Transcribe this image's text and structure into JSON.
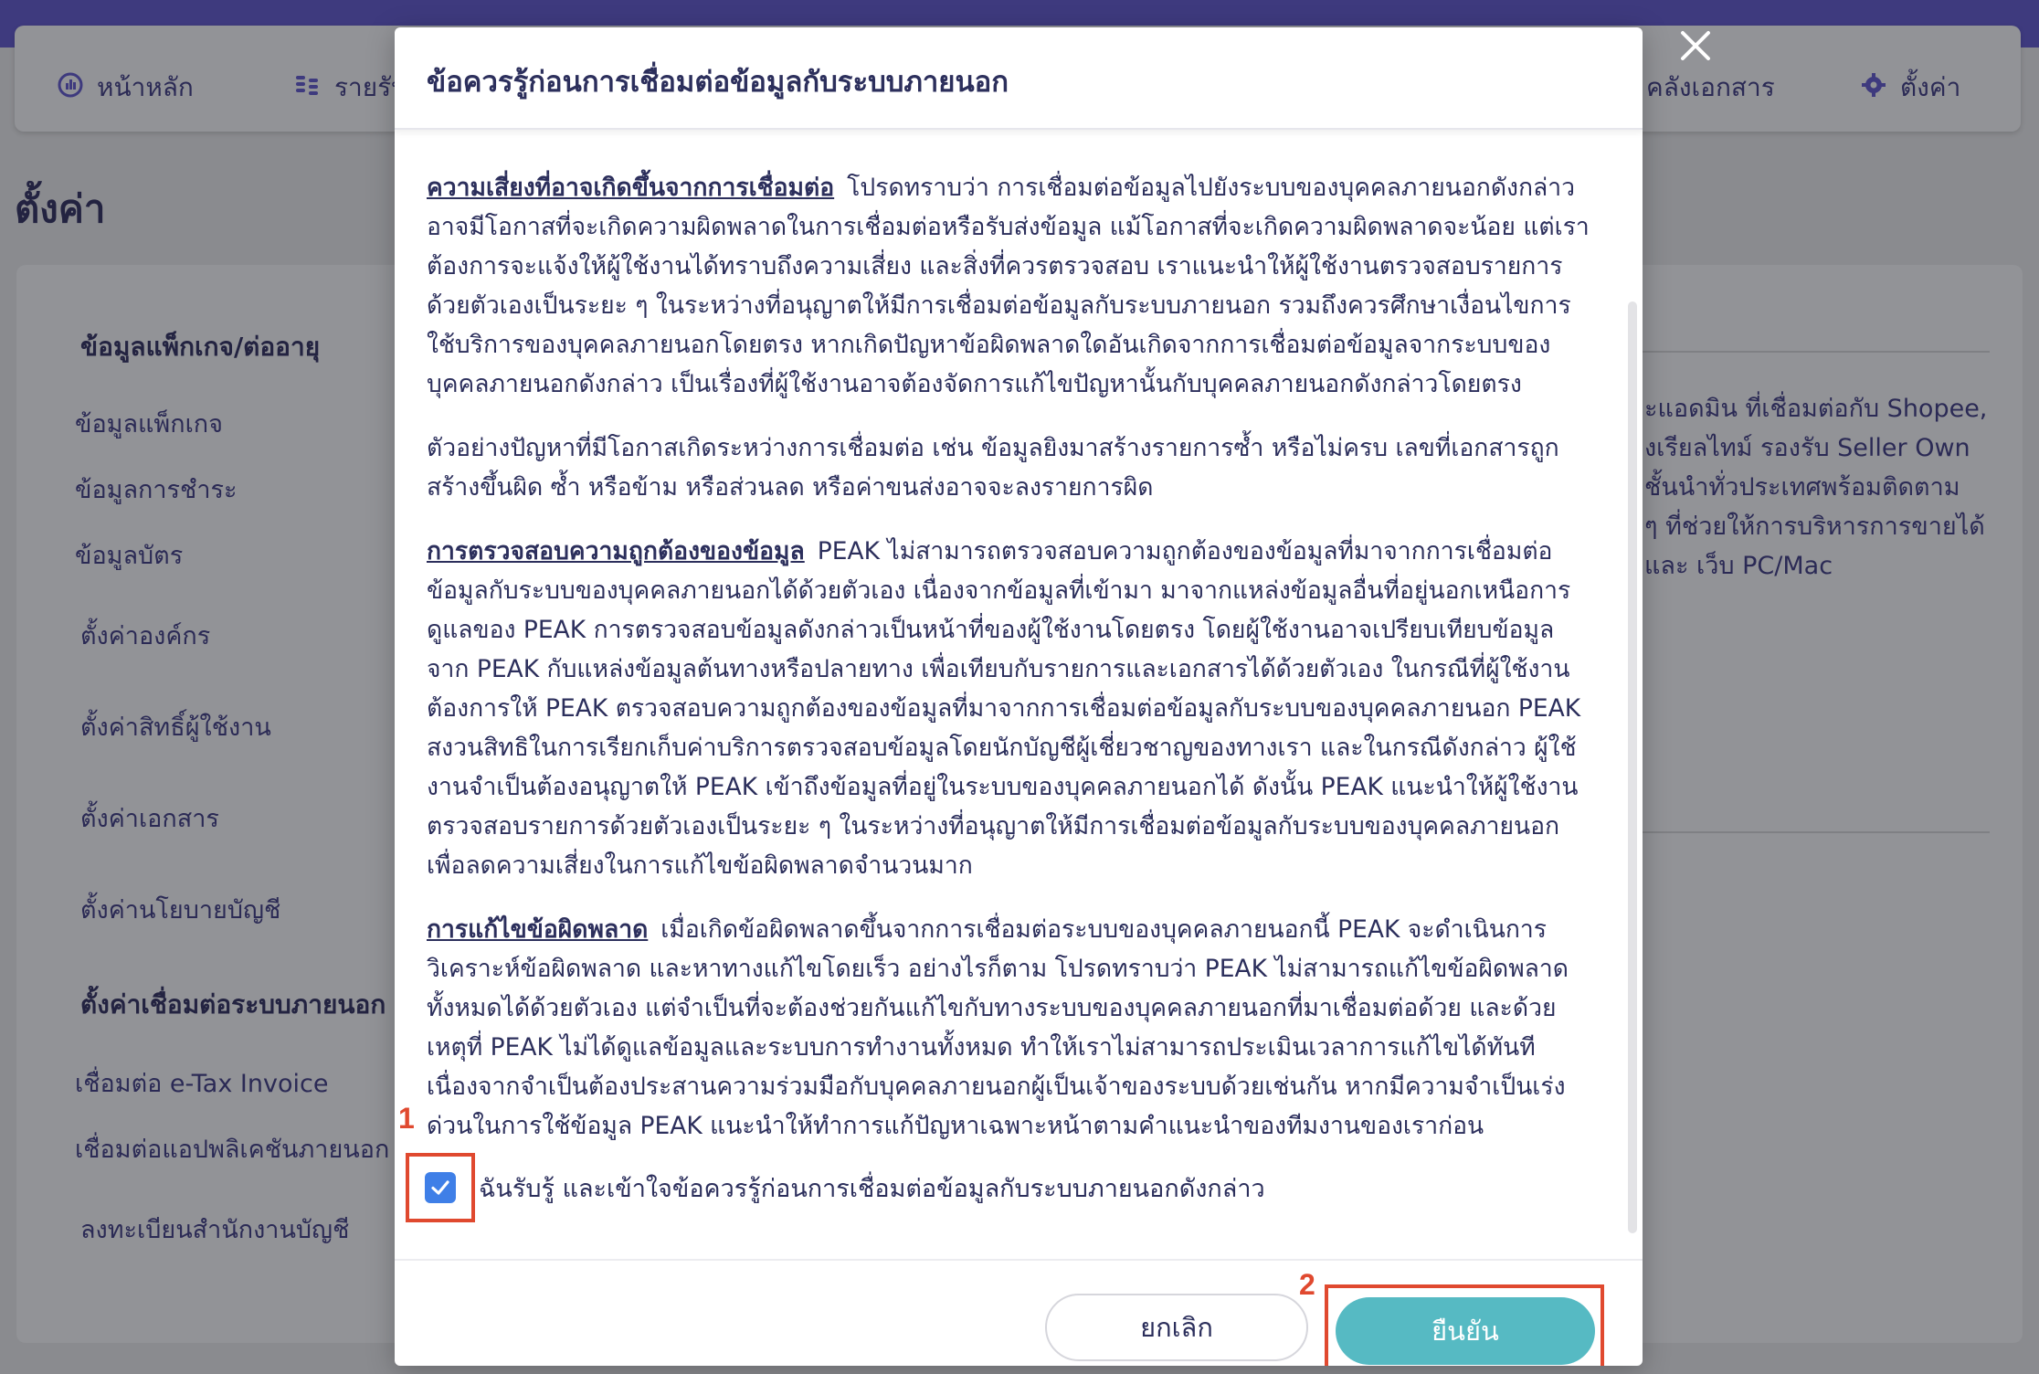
{
  "nav": {
    "home": "หน้าหลัก",
    "income": "รายรับ",
    "documents": "คลังเอกสาร",
    "settings": "ตั้งค่า"
  },
  "page": {
    "title": "ตั้งค่า"
  },
  "sidebar": {
    "package_head": "ข้อมูลแพ็กเกจ/ต่ออายุ",
    "package_info": "ข้อมูลแพ็กเกจ",
    "payment_info": "ข้อมูลการชำระ",
    "card_info": "ข้อมูลบัตร",
    "org_settings": "ตั้งค่าองค์กร",
    "user_rights": "ตั้งค่าสิทธิ์ผู้ใช้งาน",
    "doc_settings": "ตั้งค่าเอกสาร",
    "account_policy": "ตั้งค่านโยบายบัญชี",
    "external_head": "ตั้งค่าเชื่อมต่อระบบภายนอก",
    "etax": "เชื่อมต่อ e-Tax Invoice",
    "external_app": "เชื่อมต่อแอปพลิเคชันภายนอก",
    "register_office": "ลงทะเบียนสำนักงานบัญชี"
  },
  "background_right": [
    "ะแอดมิน ที่เชื่อมต่อกับ Shopee,",
    "งเรียลไทม์ รองรับ Seller Own",
    "ชั้นนำทั่วประเทศพร้อมติดตาม",
    "ๆ ที่ช่วยให้การบริหารการขายได้",
    "และ เว็บ PC/Mac"
  ],
  "modal": {
    "title": "ข้อควรรู้ก่อนการเชื่อมต่อข้อมูลกับระบบภายนอก",
    "sections": [
      {
        "head": "ความเสี่ยงที่อาจเกิดขึ้นจากการเชื่อมต่อ",
        "text": "โปรดทราบว่า การเชื่อมต่อข้อมูลไปยังระบบของบุคคลภายนอกดังกล่าว อาจมีโอกาสที่จะเกิดความผิดพลาดในการเชื่อมต่อหรือรับส่งข้อมูล แม้โอกาสที่จะเกิดความผิดพลาดจะน้อย แต่เราต้องการจะแจ้งให้ผู้ใช้งานได้ทราบถึงความเสี่ยง และสิ่งที่ควรตรวจสอบ เราแนะนำให้ผู้ใช้งานตรวจสอบรายการด้วยตัวเองเป็นระยะ ๆ ในระหว่างที่อนุญาตให้มีการเชื่อมต่อข้อมูลกับระบบภายนอก รวมถึงควรศึกษาเงื่อนไขการใช้บริการของบุคคลภายนอกโดยตรง หากเกิดปัญหาข้อผิดพลาดใดอันเกิดจากการเชื่อมต่อข้อมูลจากระบบของบุคคลภายนอกดังกล่าว เป็นเรื่องที่ผู้ใช้งานอาจต้องจัดการแก้ไขปัญหานั้นกับบุคคลภายนอกดังกล่าวโดยตรง"
      },
      {
        "head": "",
        "text": "ตัวอย่างปัญหาที่มีโอกาสเกิดระหว่างการเชื่อมต่อ เช่น ข้อมูลยิงมาสร้างรายการซ้ำ หรือไม่ครบ เลขที่เอกสารถูกสร้างขึ้นผิด ซ้ำ หรือข้าม หรือส่วนลด หรือค่าขนส่งอาจจะลงรายการผิด"
      },
      {
        "head": "การตรวจสอบความถูกต้องของข้อมูล",
        "text": "PEAK ไม่สามารถตรวจสอบความถูกต้องของข้อมูลที่มาจากการเชื่อมต่อข้อมูลกับระบบของบุคคลภายนอกได้ด้วยตัวเอง เนื่องจากข้อมูลที่เข้ามา มาจากแหล่งข้อมูลอื่นที่อยู่นอกเหนือการดูแลของ PEAK การตรวจสอบข้อมูลดังกล่าวเป็นหน้าที่ของผู้ใช้งานโดยตรง โดยผู้ใช้งานอาจเปรียบเทียบข้อมูลจาก PEAK กับแหล่งข้อมูลต้นทางหรือปลายทาง เพื่อเทียบกับรายการและเอกสารได้ด้วยตัวเอง ในกรณีที่ผู้ใช้งานต้องการให้ PEAK ตรวจสอบความถูกต้องของข้อมูลที่มาจากการเชื่อมต่อข้อมูลกับระบบของบุคคลภายนอก PEAK สงวนสิทธิในการเรียกเก็บค่าบริการตรวจสอบข้อมูลโดยนักบัญชีผู้เชี่ยวชาญของทางเรา และในกรณีดังกล่าว ผู้ใช้งานจำเป็นต้องอนุญาตให้ PEAK เข้าถึงข้อมูลที่อยู่ในระบบของบุคคลภายนอกได้ ดังนั้น PEAK แนะนำให้ผู้ใช้งานตรวจสอบรายการด้วยตัวเองเป็นระยะ ๆ ในระหว่างที่อนุญาตให้มีการเชื่อมต่อข้อมูลกับระบบของบุคคลภายนอก เพื่อลดความเสี่ยงในการแก้ไขข้อผิดพลาดจำนวนมาก"
      },
      {
        "head": "การแก้ไขข้อผิดพลาด",
        "text": "เมื่อเกิดข้อผิดพลาดขึ้นจากการเชื่อมต่อระบบของบุคคลภายนอกนี้ PEAK จะดำเนินการวิเคราะห์ข้อผิดพลาด และหาทางแก้ไขโดยเร็ว อย่างไรก็ตาม โปรดทราบว่า PEAK ไม่สามารถแก้ไขข้อผิดพลาดทั้งหมดได้ด้วยตัวเอง แต่จำเป็นที่จะต้องช่วยกันแก้ไขกับทางระบบของบุคคลภายนอกที่มาเชื่อมต่อด้วย และด้วยเหตุที่ PEAK ไม่ได้ดูแลข้อมูลและระบบการทำงานทั้งหมด ทำให้เราไม่สามารถประเมินเวลาการแก้ไขได้ทันที เนื่องจากจำเป็นต้องประสานความร่วมมือกับบุคคลภายนอกผู้เป็นเจ้าของระบบด้วยเช่นกัน หากมีความจำเป็นเร่งด่วนในการใช้ข้อมูล PEAK แนะนำให้ทำการแก้ปัญหาเฉพาะหน้าตามคำแนะนำของทีมงานของเราก่อน"
      }
    ],
    "ack_label": "ฉันรับรู้ และเข้าใจข้อควรรู้ก่อนการเชื่อมต่อข้อมูลกับระบบภายนอกดังกล่าว",
    "ack_checked": true,
    "cancel_label": "ยกเลิก",
    "confirm_label": "ยืนยัน"
  },
  "annotations": {
    "marker_1": "1",
    "marker_2": "2"
  },
  "colors": {
    "accent": "#56bac3",
    "checkbox": "#3f7fe7",
    "highlight": "#e0492f",
    "text": "#2c2f5c"
  },
  "icons": [
    "chart-icon",
    "coins-icon",
    "gear-icon",
    "close-icon",
    "check-icon"
  ]
}
